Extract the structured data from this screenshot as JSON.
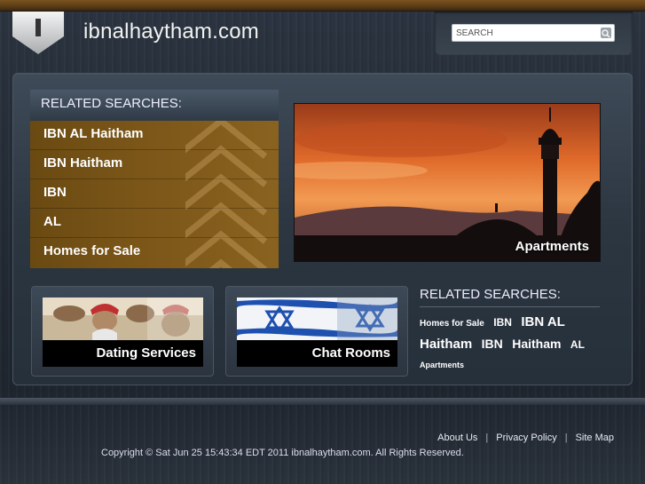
{
  "header": {
    "logo_letter": "I",
    "site_title": "ibnalhaytham.com",
    "search": {
      "placeholder": "SEARCH"
    }
  },
  "related_searches": {
    "heading": "RELATED SEARCHES:",
    "items": [
      {
        "label": "IBN AL Haitham"
      },
      {
        "label": "IBN Haitham"
      },
      {
        "label": "IBN"
      },
      {
        "label": "AL"
      },
      {
        "label": "Homes for Sale"
      }
    ]
  },
  "hero": {
    "label": "Apartments"
  },
  "tiles": [
    {
      "label": "Dating Services"
    },
    {
      "label": "Chat Rooms"
    }
  ],
  "related_searches_2": {
    "heading": "RELATED SEARCHES:",
    "cloud": [
      {
        "label": "Homes for Sale",
        "size": "s10"
      },
      {
        "label": "IBN",
        "size": "s12"
      },
      {
        "label": "IBN AL",
        "size": "s15"
      },
      {
        "label": "Haitham",
        "size": "s15"
      },
      {
        "label": "IBN",
        "size": "s14"
      },
      {
        "label": "Haitham",
        "size": "s14"
      },
      {
        "label": "AL",
        "size": "s12"
      },
      {
        "label": "Apartments",
        "size": "s9"
      }
    ]
  },
  "footer": {
    "links": [
      {
        "label": "About Us"
      },
      {
        "label": "Privacy Policy"
      },
      {
        "label": "Site Map"
      }
    ],
    "copyright": "Copyright © Sat Jun 25 15:43:34 EDT 2011 ibnalhaytham.com. All Rights Reserved."
  },
  "colors": {
    "accent_brown": "#7a5518",
    "panel": "#2c3641"
  }
}
